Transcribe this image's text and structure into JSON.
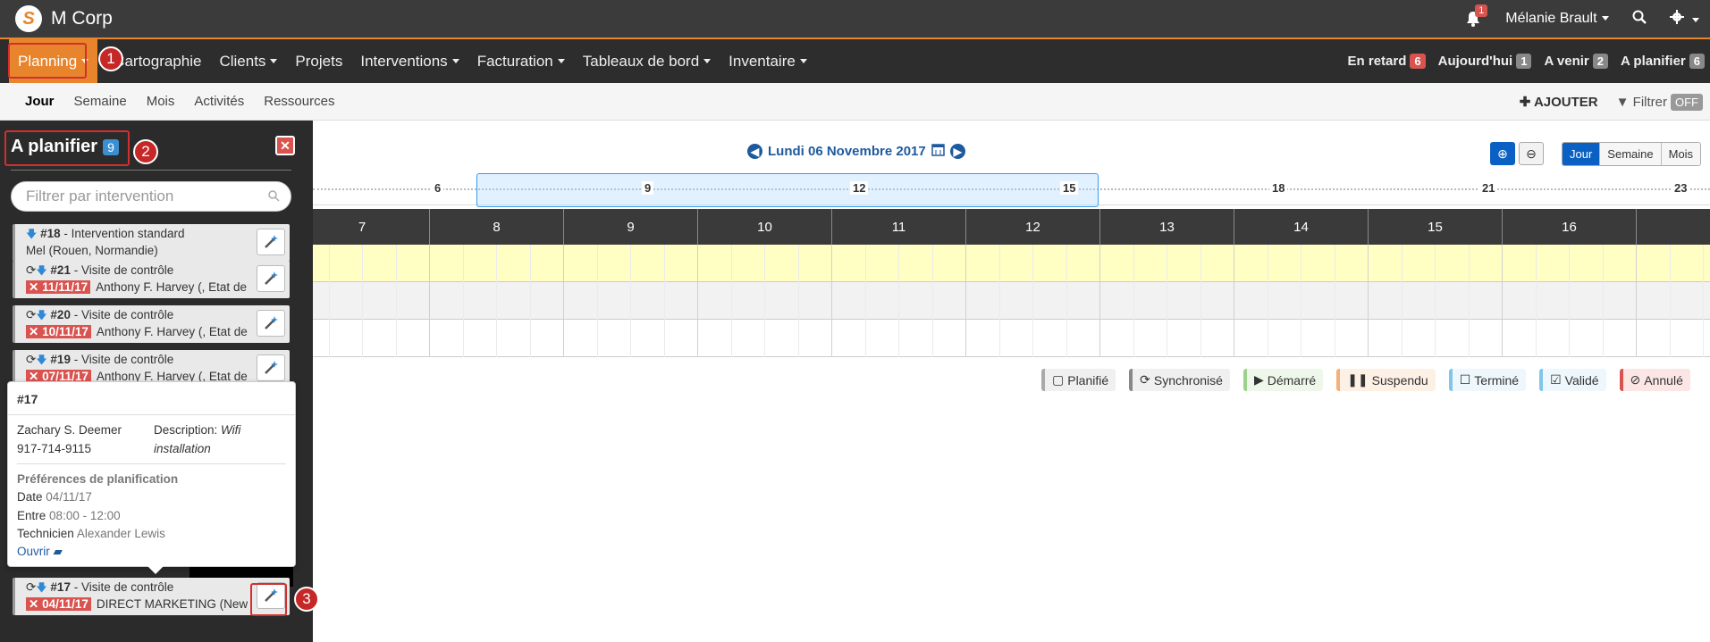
{
  "app": {
    "brand": "M Corp",
    "logo_letter": "S"
  },
  "topbar": {
    "notif_count": "1",
    "user": "Mélanie Brault"
  },
  "nav": {
    "items": [
      "Planning",
      "Cartographie",
      "Clients",
      "Projets",
      "Interventions",
      "Facturation",
      "Tableaux de bord",
      "Inventaire"
    ],
    "counters": [
      {
        "label": "En retard",
        "count": "6"
      },
      {
        "label": "Aujourd'hui",
        "count": "1"
      },
      {
        "label": "A venir",
        "count": "2"
      },
      {
        "label": "A planifier",
        "count": "6"
      }
    ]
  },
  "subnav": {
    "tabs": [
      "Jour",
      "Semaine",
      "Mois",
      "Activités",
      "Ressources"
    ],
    "add_label": "AJOUTER",
    "filter_label": "Filtrer",
    "filter_state": "OFF"
  },
  "calendar": {
    "date_title": "Lundi 06 Novembre 2017",
    "views": [
      "Jour",
      "Semaine",
      "Mois"
    ],
    "ruler_labels": [
      "6",
      "9",
      "12",
      "15",
      "18",
      "21",
      "23"
    ],
    "hours": [
      "7",
      "8",
      "9",
      "10",
      "11",
      "12",
      "13",
      "14",
      "15",
      "16"
    ],
    "legend": [
      "Planifié",
      "Synchronisé",
      "Démarré",
      "Suspendu",
      "Terminé",
      "Validé",
      "Annulé"
    ]
  },
  "panel": {
    "title": "A planifier",
    "count": "9",
    "search_placeholder": "Filtrer par intervention",
    "cards": [
      {
        "num": "#18",
        "type": "Intervention standard",
        "date": "",
        "client": "Mel (Rouen, Normandie)"
      },
      {
        "num": "#21",
        "type": "Visite de contrôle",
        "date": "11/11/17",
        "client": "Anthony F. Harvey (, Etat de"
      },
      {
        "num": "#20",
        "type": "Visite de contrôle",
        "date": "10/11/17",
        "client": "Anthony F. Harvey (, Etat de"
      },
      {
        "num": "#19",
        "type": "Visite de contrôle",
        "date": "07/11/17",
        "client": "Anthony F. Harvey (, Etat de"
      },
      {
        "num": "#17",
        "type": "Visite de contrôle",
        "date": "04/11/17",
        "client": "DIRECT MARKETING (New"
      }
    ]
  },
  "tooltip": {
    "title": "#17",
    "contact_name": "Zachary S. Deemer",
    "contact_phone": "917-714-9115",
    "desc_label": "Description:",
    "desc_value_1": "Wifi",
    "desc_value_2": "installation",
    "prefs_title": "Préférences de planification",
    "date_label": "Date",
    "date_value": "04/11/17",
    "between_label": "Entre",
    "between_value": "08:00 - 12:00",
    "tech_label": "Technicien",
    "tech_value": "Alexander Lewis",
    "open_label": "Ouvrir"
  },
  "annotations": [
    "1",
    "2",
    "3"
  ],
  "colors": {
    "accent": "#e7842c",
    "dark": "#2d2d2d",
    "blue": "#0b61c3",
    "red": "#d9534f"
  }
}
